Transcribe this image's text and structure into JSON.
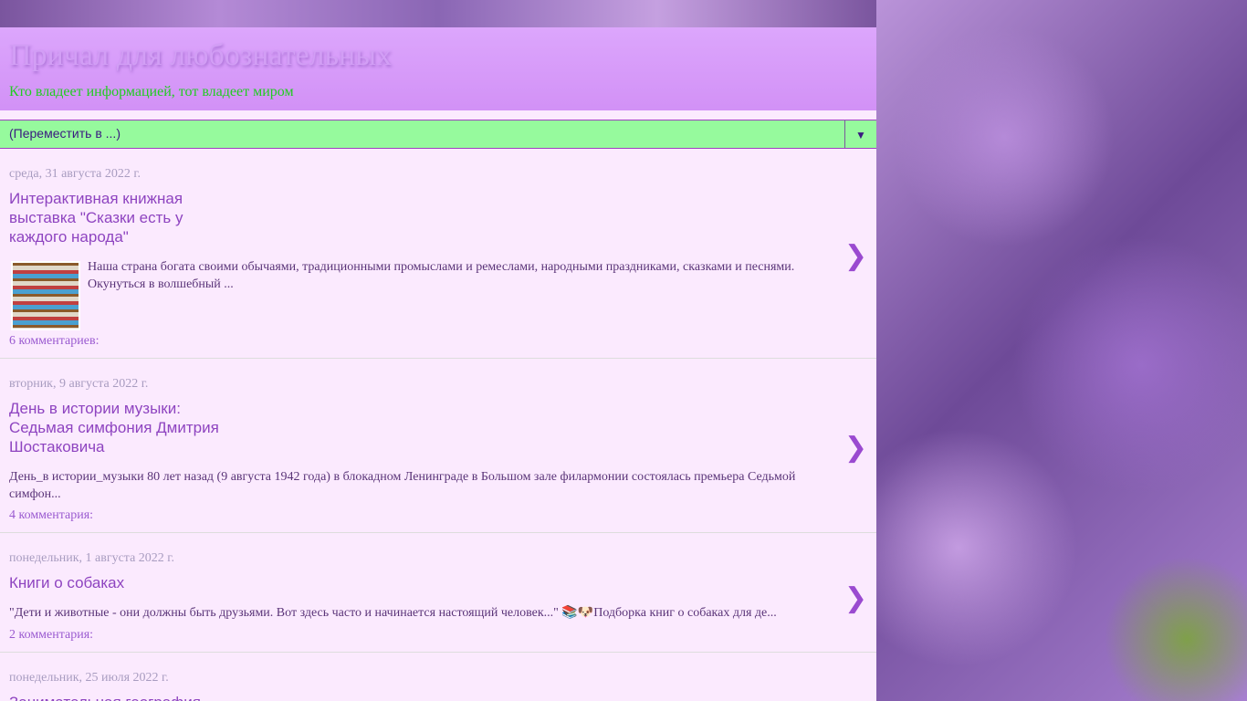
{
  "blog": {
    "title": "Причал для любознательных",
    "description": "Кто владеет информацией, тот владеет миром"
  },
  "nav": {
    "label": "(Переместить в ...)",
    "arrow": "▼"
  },
  "posts": [
    {
      "date": "среда, 31 августа 2022 г.",
      "title": "Интерактивная книжная выставка \"Сказки есть у каждого народа\"",
      "snippet": "Наша страна богата своими обычаями, традиционными промыслами и ремеслами, народными праздниками, сказками и песнями. Окунуться в волшебный ...",
      "comments": "6 комментариев:"
    },
    {
      "date": "вторник, 9 августа 2022 г.",
      "title": "День в истории музыки: Седьмая симфония Дмитрия Шостаковича",
      "snippet": "День_в истории_музыки 80 лет назад (9 августа 1942 года) в блокадном Ленинграде в Большом зале филармонии состоялась премьера Седьмой симфон...",
      "comments": "4 комментария:"
    },
    {
      "date": "понедельник, 1 августа 2022 г.",
      "title": "Книги о собаках",
      "snippet": "\"Дети и животные - они должны быть друзьями. Вот здесь часто и начинается настоящий человек...\" 📚🐶Подборка книг о собаках для де...",
      "comments": "2 комментария:"
    },
    {
      "date": "понедельник, 25 июля 2022 г.",
      "title": "Занимательная география"
    }
  ],
  "chevron": "❯"
}
